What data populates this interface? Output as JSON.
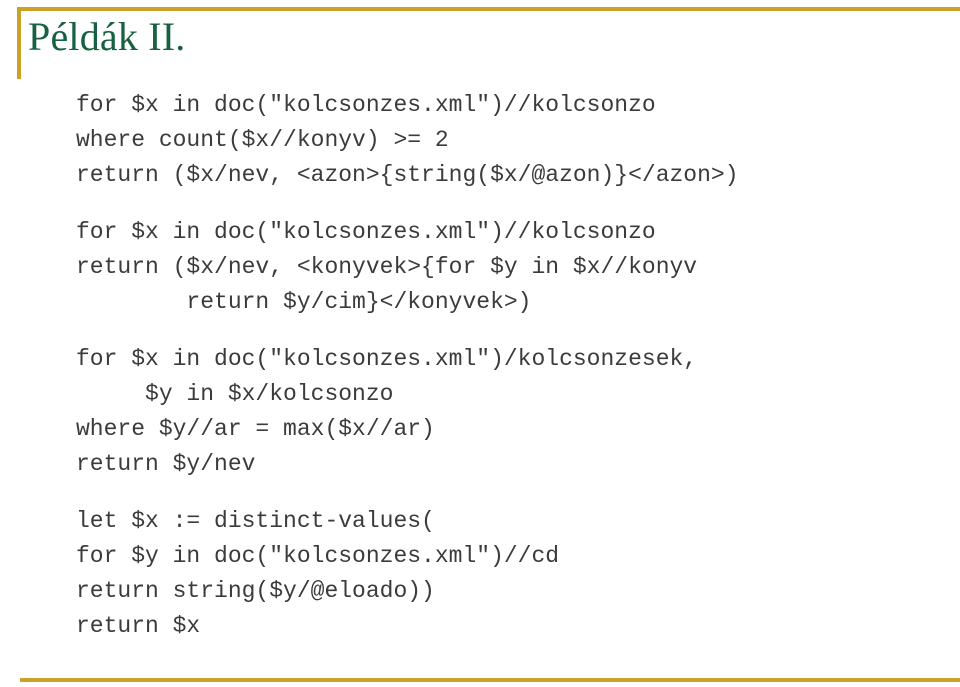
{
  "slide": {
    "title": "Példák II.",
    "title_color": "#16613f",
    "accent_color": "#c9a227",
    "code_color": "#3b3b3b",
    "background_color": "#ffffff"
  },
  "code_blocks": [
    {
      "id": "query-1",
      "lines": [
        "for $x in doc(\"kolcsonzes.xml\")//kolcsonzo",
        "where count($x//konyv) >= 2",
        "return ($x/nev, <azon>{string($x/@azon)}</azon>)"
      ]
    },
    {
      "id": "query-2",
      "lines": [
        "for $x in doc(\"kolcsonzes.xml\")//kolcsonzo",
        "return ($x/nev, <konyvek>{for $y in $x//konyv",
        "        return $y/cim}</konyvek>)"
      ]
    },
    {
      "id": "query-3",
      "lines": [
        "for $x in doc(\"kolcsonzes.xml\")/kolcsonzesek,",
        "     $y in $x/kolcsonzo",
        "where $y//ar = max($x//ar)",
        "return $y/nev"
      ]
    },
    {
      "id": "query-4",
      "lines": [
        "let $x := distinct-values(",
        "for $y in doc(\"kolcsonzes.xml\")//cd",
        "return string($y/@eloado))",
        "return $x"
      ]
    }
  ]
}
